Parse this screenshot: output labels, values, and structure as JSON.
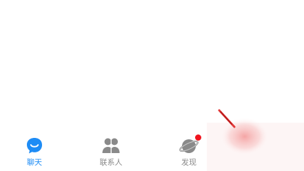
{
  "colors": {
    "accent": "#1e8cf5",
    "inactive": "#8a8a8a",
    "badge": "#f0141e",
    "background": "#ffffff"
  },
  "tab_bar": {
    "tabs": [
      {
        "label": "聊天",
        "icon": "chat-bubble-icon",
        "active": true
      },
      {
        "label": "联系人",
        "icon": "contacts-people-icon",
        "active": false
      },
      {
        "label": "发现",
        "icon": "discover-planet-icon",
        "active": false,
        "badge": "dot"
      }
    ]
  }
}
